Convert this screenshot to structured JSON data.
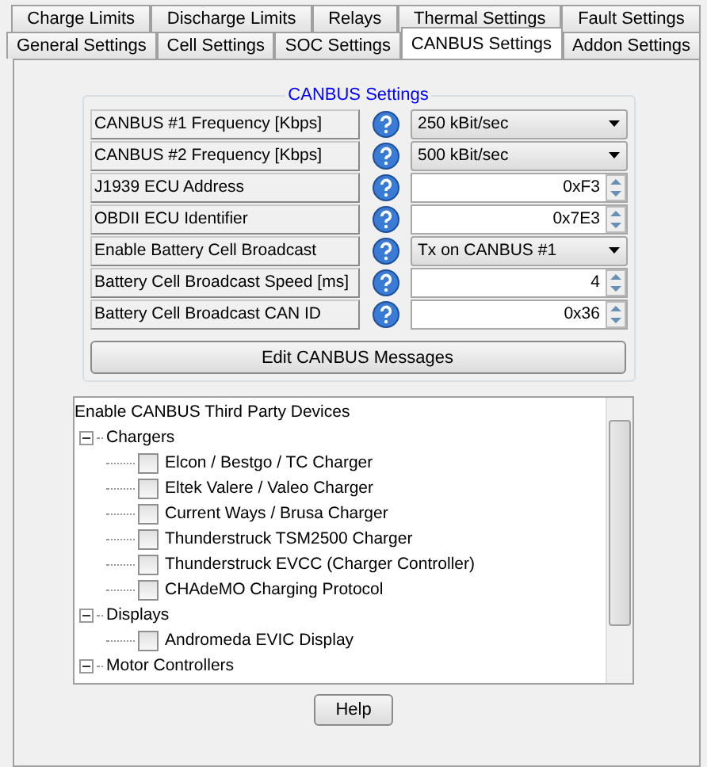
{
  "tab_rows": [
    [
      {
        "label": "Charge Limits",
        "selected": false
      },
      {
        "label": "Discharge Limits",
        "selected": false
      },
      {
        "label": "Relays",
        "selected": false
      },
      {
        "label": "Thermal Settings",
        "selected": false
      },
      {
        "label": "Fault Settings",
        "selected": false
      }
    ],
    [
      {
        "label": "General Settings",
        "selected": false
      },
      {
        "label": "Cell Settings",
        "selected": false
      },
      {
        "label": "SOC Settings",
        "selected": false
      },
      {
        "label": "CANBUS Settings",
        "selected": true
      },
      {
        "label": "Addon Settings",
        "selected": false
      }
    ]
  ],
  "group": {
    "title": "CANBUS Settings",
    "settings": [
      {
        "label": "CANBUS #1 Frequency [Kbps]",
        "kind": "dropdown",
        "value": "250 kBit/sec"
      },
      {
        "label": "CANBUS #2 Frequency [Kbps]",
        "kind": "dropdown",
        "value": "500 kBit/sec"
      },
      {
        "label": "J1939 ECU Address",
        "kind": "spin",
        "value": "0xF3"
      },
      {
        "label": "OBDII ECU Identifier",
        "kind": "spin",
        "value": "0x7E3"
      },
      {
        "label": "Enable Battery Cell Broadcast",
        "kind": "dropdown",
        "value": "Tx on CANBUS #1"
      },
      {
        "label": "Battery Cell Broadcast Speed [ms]",
        "kind": "spin",
        "value": "4"
      },
      {
        "label": "Battery Cell Broadcast CAN ID",
        "kind": "spin",
        "value": "0x36"
      }
    ],
    "button": "Edit CANBUS Messages"
  },
  "tree": {
    "title": "Enable CANBUS Third Party Devices",
    "items": [
      {
        "label": "Chargers",
        "expanded": true,
        "children": [
          {
            "label": "Elcon / Bestgo / TC Charger",
            "checked": false
          },
          {
            "label": "Eltek Valere / Valeo Charger",
            "checked": false
          },
          {
            "label": "Current Ways / Brusa Charger",
            "checked": false
          },
          {
            "label": "Thunderstruck TSM2500 Charger",
            "checked": false
          },
          {
            "label": "Thunderstruck EVCC (Charger Controller)",
            "checked": false
          },
          {
            "label": "CHAdeMO Charging Protocol",
            "checked": false
          }
        ]
      },
      {
        "label": "Displays",
        "expanded": true,
        "children": [
          {
            "label": "Andromeda EVIC Display",
            "checked": false
          }
        ]
      },
      {
        "label": "Motor Controllers",
        "expanded": true
      }
    ]
  },
  "help_button": "Help"
}
